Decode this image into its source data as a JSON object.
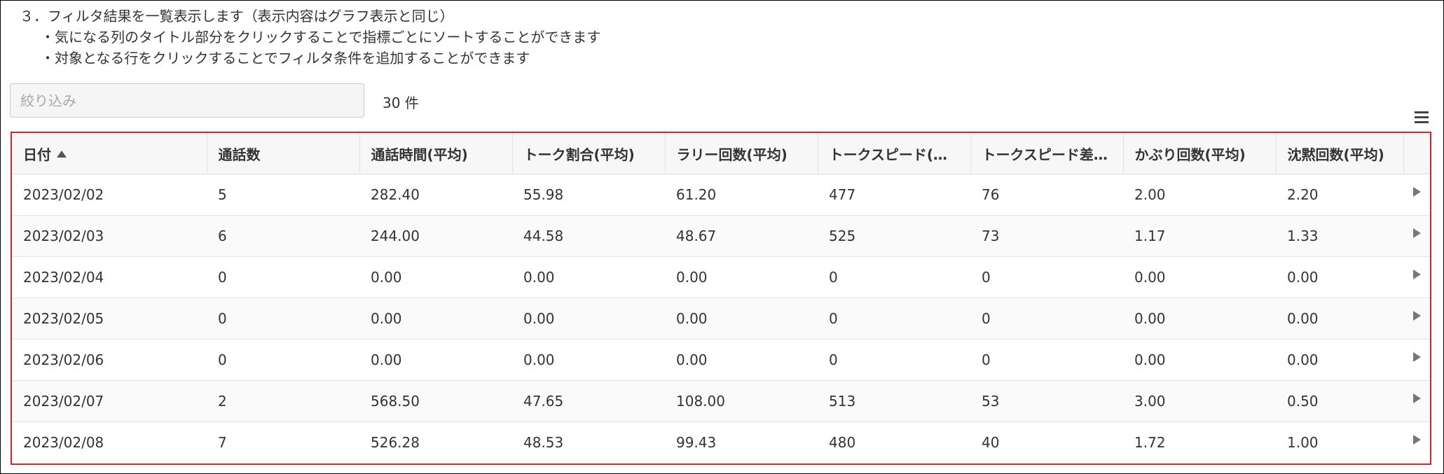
{
  "instructions": {
    "line1": "３．フィルタ結果を一覧表示します（表示内容はグラフ表示と同じ）",
    "line2": "・気になる列のタイトル部分をクリックすることで指標ごとにソートすることができます",
    "line3": "・対象となる行をクリックすることでフィルタ条件を追加することができます"
  },
  "filter": {
    "placeholder": "絞り込み",
    "value": ""
  },
  "count_label": "30 件",
  "icons": {
    "menu": "hamburger-menu-icon",
    "sort": "sort-ascending-icon",
    "row": "play-arrow-icon"
  },
  "colors": {
    "highlight_border": "#e0202a"
  },
  "table": {
    "sorted_column": "日付",
    "sort_direction": "ascending",
    "headers": [
      "日付",
      "通話数",
      "通話時間(平均)",
      "トーク割合(平均)",
      "ラリー回数(平均)",
      "トークスピード(…",
      "トークスピード差…",
      "かぶり回数(平均)",
      "沈黙回数(平均)"
    ],
    "rows": [
      [
        "2023/02/02",
        "5",
        "282.40",
        "55.98",
        "61.20",
        "477",
        "76",
        "2.00",
        "2.20"
      ],
      [
        "2023/02/03",
        "6",
        "244.00",
        "44.58",
        "48.67",
        "525",
        "73",
        "1.17",
        "1.33"
      ],
      [
        "2023/02/04",
        "0",
        "0.00",
        "0.00",
        "0.00",
        "0",
        "0",
        "0.00",
        "0.00"
      ],
      [
        "2023/02/05",
        "0",
        "0.00",
        "0.00",
        "0.00",
        "0",
        "0",
        "0.00",
        "0.00"
      ],
      [
        "2023/02/06",
        "0",
        "0.00",
        "0.00",
        "0.00",
        "0",
        "0",
        "0.00",
        "0.00"
      ],
      [
        "2023/02/07",
        "2",
        "568.50",
        "47.65",
        "108.00",
        "513",
        "53",
        "3.00",
        "0.50"
      ],
      [
        "2023/02/08",
        "7",
        "526.28",
        "48.53",
        "99.43",
        "480",
        "40",
        "1.72",
        "1.00"
      ]
    ]
  }
}
